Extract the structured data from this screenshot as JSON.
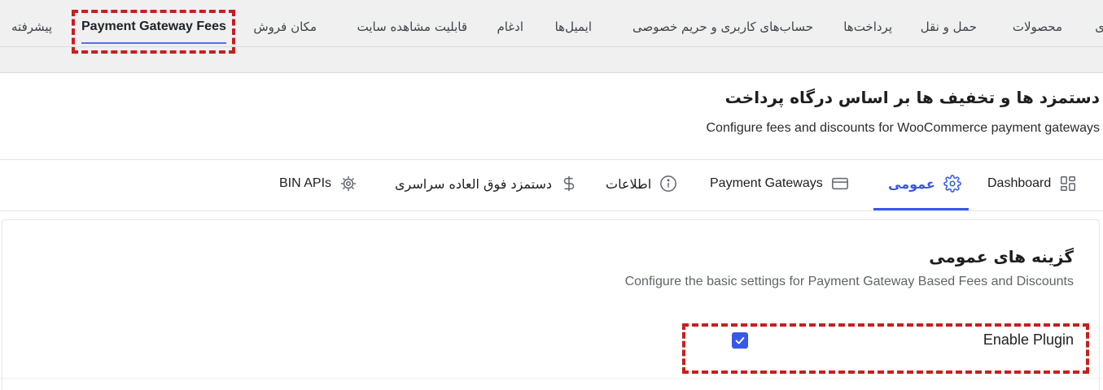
{
  "top_tabs": [
    {
      "label": "ی",
      "active": false
    },
    {
      "label": "محصولات",
      "active": false
    },
    {
      "label": "حمل و نقل",
      "active": false
    },
    {
      "label": "پرداخت‌ها",
      "active": false
    },
    {
      "label": "حساب‌های کاربری و حریم خصوصی",
      "active": false
    },
    {
      "label": "ایمیل‌ها",
      "active": false
    },
    {
      "label": "ادغام",
      "active": false
    },
    {
      "label": "قابلیت مشاهده سایت",
      "active": false
    },
    {
      "label": "مکان فروش",
      "active": false
    },
    {
      "label": "Payment Gateway Fees",
      "active": true
    },
    {
      "label": "پیشرفته",
      "active": false
    }
  ],
  "plugin": {
    "title": "دستمزد ها و تخفیف ها بر اساس درگاه پرداخت",
    "subtitle": "Configure fees and discounts for WooCommerce payment gateways"
  },
  "nav_tabs": [
    {
      "label": "Dashboard",
      "icon": "dashboard-grid-icon",
      "active": false
    },
    {
      "label": "عمومی",
      "icon": "gear-icon",
      "active": true
    },
    {
      "label": "Payment Gateways",
      "icon": "credit-card-icon",
      "active": false
    },
    {
      "label": "اطلاعات",
      "icon": "info-icon",
      "active": false
    },
    {
      "label": "دستمزد فوق العاده سراسری",
      "icon": "dollar-icon",
      "active": false
    },
    {
      "label": "BIN APIs",
      "icon": "cog-api-icon",
      "active": false
    }
  ],
  "general": {
    "title": "گزینه های عمومی",
    "description": "Configure the basic settings for Payment Gateway Based Fees and Discounts",
    "enable_plugin": {
      "label": "Enable Plugin",
      "checked": true
    }
  },
  "colors": {
    "accent": "#3858e9",
    "highlight_dashes": "#c5201f",
    "topbar_bg": "#f0f0f1"
  }
}
